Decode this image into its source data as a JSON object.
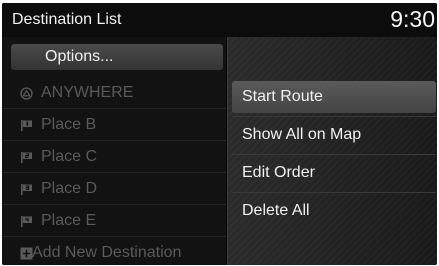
{
  "header": {
    "title": "Destination List",
    "clock": "9:30"
  },
  "list": {
    "options_label": "Options...",
    "items": [
      {
        "label": "ANYWHERE",
        "icon": "anywhere-icon"
      },
      {
        "label": "Place B",
        "icon": "waypoint-flag-1-icon"
      },
      {
        "label": "Place C",
        "icon": "waypoint-flag-2-icon"
      },
      {
        "label": "Place D",
        "icon": "waypoint-flag-3-icon"
      },
      {
        "label": "Place E",
        "icon": "waypoint-flag-4-icon"
      },
      {
        "label": "Add New Destination",
        "icon": "plus-icon"
      }
    ]
  },
  "menu": {
    "items": [
      {
        "label": "Start Route",
        "selected": true
      },
      {
        "label": "Show All on Map",
        "selected": false
      },
      {
        "label": "Edit Order",
        "selected": false
      },
      {
        "label": "Delete All",
        "selected": false
      }
    ]
  },
  "colors": {
    "background": "#050505",
    "text": "#f2f2f2",
    "dimmed_text": "#5a5a5a",
    "highlight": "#4a4a4a"
  }
}
